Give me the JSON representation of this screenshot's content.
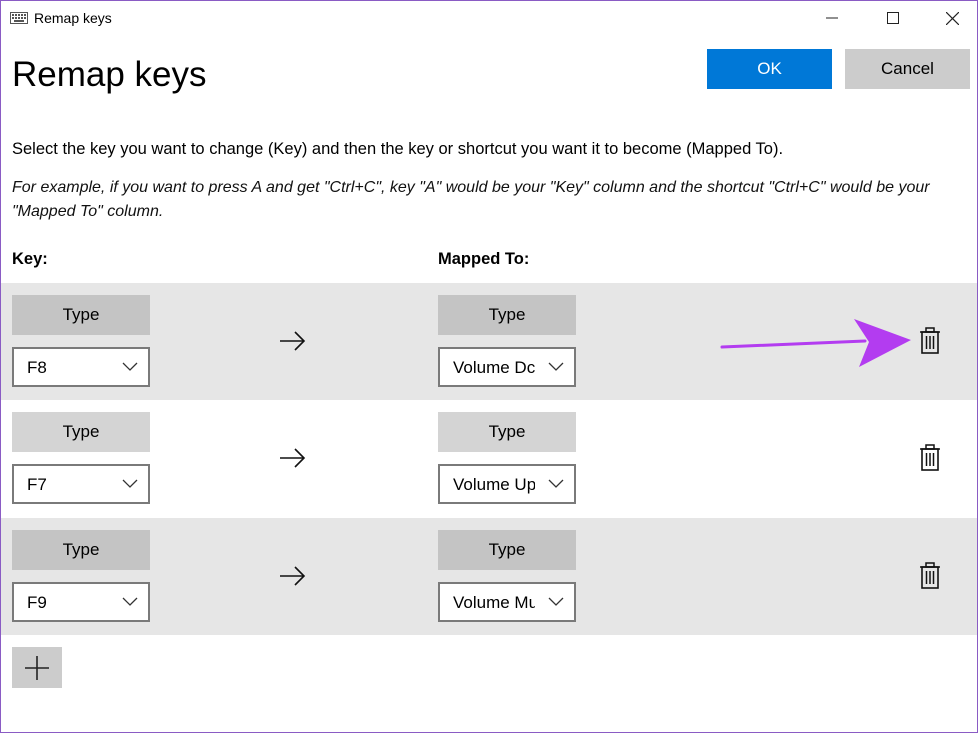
{
  "window": {
    "title": "Remap keys",
    "icon": "keyboard-icon",
    "controls": [
      "minimize-icon",
      "maximize-icon",
      "close-icon"
    ]
  },
  "header": {
    "title": "Remap keys",
    "ok_label": "OK",
    "cancel_label": "Cancel"
  },
  "instructions": {
    "main": "Select the key you want to change (Key) and then the key or shortcut you want it to become (Mapped To).",
    "example": "For example, if you want to press A and get \"Ctrl+C\", key \"A\" would be your \"Key\" column and the shortcut \"Ctrl+C\" would be your \"Mapped To\" column."
  },
  "columns": {
    "key": "Key:",
    "mapped": "Mapped To:"
  },
  "mappings": [
    {
      "type_label": "Type",
      "key": "F8",
      "mapped_type_label": "Type",
      "mapped": "Volume Dc",
      "shaded": true
    },
    {
      "type_label": "Type",
      "key": "F7",
      "mapped_type_label": "Type",
      "mapped": "Volume Up",
      "shaded": false
    },
    {
      "type_label": "Type",
      "key": "F9",
      "mapped_type_label": "Type",
      "mapped": "Volume Mu",
      "shaded": true
    }
  ],
  "colors": {
    "accent": "#0078d7",
    "annotation": "#b33cf0",
    "row_shade": "#e6e6e6"
  }
}
